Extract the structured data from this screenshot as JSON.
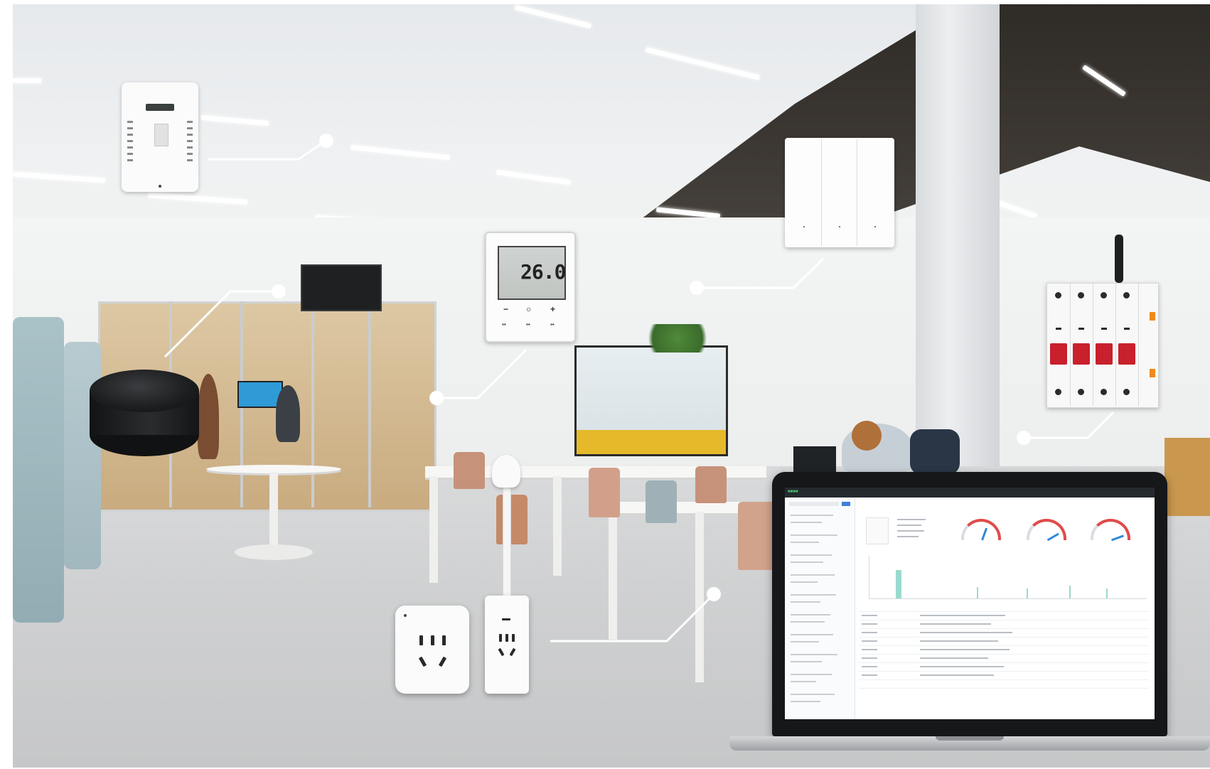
{
  "image": {
    "description": "Open-plan office interior with ceiling lights, meeting room, study tables and chairs, overlaid with smart-building IoT device cutouts connected by white callout lines, and a laptop showing a device-monitoring dashboard",
    "devices": [
      {
        "name": "wall air-quality sensor panel",
        "icon": "sensor-panel"
      },
      {
        "name": "infrared remote hub",
        "icon": "ir-hub"
      },
      {
        "name": "air-conditioner thermostat controller",
        "icon": "thermostat"
      },
      {
        "name": "three-gang wall switch",
        "icon": "wall-switch"
      },
      {
        "name": "smart circuit breaker",
        "icon": "breaker"
      },
      {
        "name": "smart wall socket",
        "icon": "socket"
      },
      {
        "name": "smart plug adapter",
        "icon": "plug"
      }
    ],
    "colors": {
      "callout": "#ffffff",
      "breaker_lever": "#c8202c",
      "dashboard_accent": "#49c16e",
      "floor": "#cfd0d1"
    }
  },
  "thermostat": {
    "temperature": "26.0"
  }
}
